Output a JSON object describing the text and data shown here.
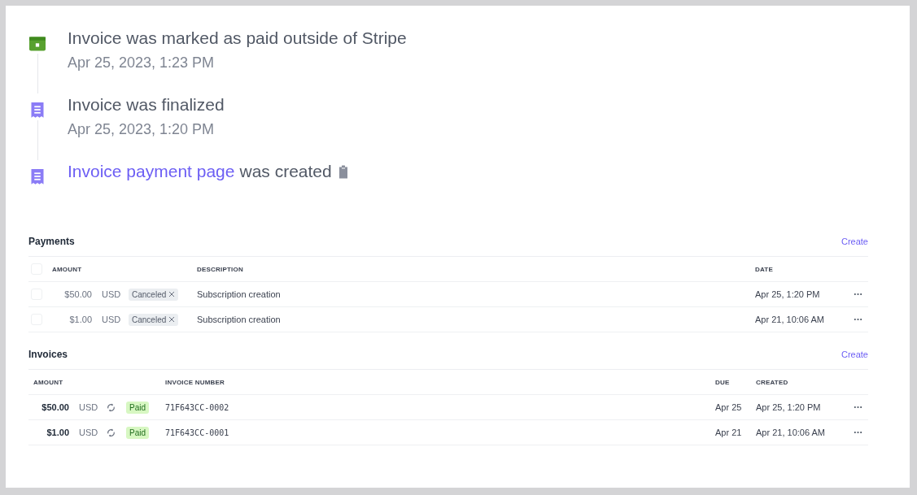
{
  "timeline": [
    {
      "kind": "cash",
      "title": "Invoice was marked as paid outside of Stripe",
      "time": "Apr 25, 2023, 1:23 PM"
    },
    {
      "kind": "receipt",
      "title": "Invoice was finalized",
      "time": "Apr 25, 2023, 1:20 PM"
    },
    {
      "kind": "receipt",
      "link": "Invoice payment page",
      "title": "was created"
    }
  ],
  "payments": {
    "title": "Payments",
    "action": "Create",
    "select_all_checked": false,
    "columns": [
      "AMOUNT",
      "DESCRIPTION",
      "DATE"
    ],
    "rows": [
      {
        "checked": false,
        "amount": "$50.00",
        "currency": "USD",
        "status": "Canceled",
        "description": "Subscription creation",
        "date": "Apr 25, 1:20 PM"
      },
      {
        "checked": false,
        "amount": "$1.00",
        "currency": "USD",
        "status": "Canceled",
        "description": "Subscription creation",
        "date": "Apr 21, 10:06 AM"
      }
    ]
  },
  "invoices": {
    "title": "Invoices",
    "action": "Create",
    "columns": [
      "AMOUNT",
      "INVOICE NUMBER",
      "DUE",
      "CREATED"
    ],
    "rows": [
      {
        "amount": "$50.00",
        "currency": "USD",
        "status": "Paid",
        "number": "71F643CC-0002",
        "due": "Apr 25",
        "created": "Apr 25, 1:20 PM"
      },
      {
        "amount": "$1.00",
        "currency": "USD",
        "status": "Paid",
        "number": "71F643CC-0001",
        "due": "Apr 21",
        "created": "Apr 21, 10:06 AM"
      }
    ]
  }
}
